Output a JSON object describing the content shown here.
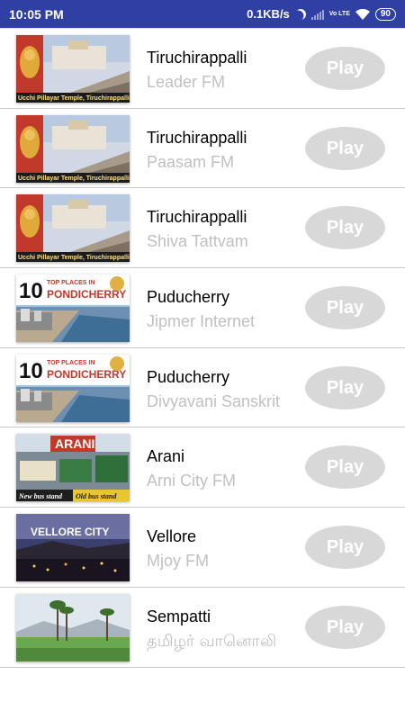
{
  "status_bar": {
    "time": "10:05 PM",
    "net_speed": "0.1KB/s",
    "volte": "Vo LTE",
    "battery": "90"
  },
  "stations": [
    {
      "city": "Tiruchirappalli",
      "name": "Leader FM",
      "play_label": "Play",
      "thumb": "temple",
      "thumb_caption": "Ucchi Pillayar Temple, Tiruchirappalli"
    },
    {
      "city": "Tiruchirappalli",
      "name": "Paasam FM",
      "play_label": "Play",
      "thumb": "temple",
      "thumb_caption": "Ucchi Pillayar Temple, Tiruchirappalli"
    },
    {
      "city": "Tiruchirappalli",
      "name": "Shiva Tattvam",
      "play_label": "Play",
      "thumb": "temple",
      "thumb_caption": "Ucchi Pillayar Temple, Tiruchirappalli"
    },
    {
      "city": "Puducherry",
      "name": "Jipmer Internet",
      "play_label": "Play",
      "thumb": "pondy",
      "thumb_caption": "10 TOP PLACES IN PONDICHERRY"
    },
    {
      "city": "Puducherry",
      "name": "Divyavani Sanskrit",
      "play_label": "Play",
      "thumb": "pondy",
      "thumb_caption": "10 TOP PLACES IN PONDICHERRY"
    },
    {
      "city": "Arani",
      "name": "Arni City FM",
      "play_label": "Play",
      "thumb": "arani",
      "thumb_caption": "ARANI New bus stand Old bus stand"
    },
    {
      "city": "Vellore",
      "name": "Mjoy FM",
      "play_label": "Play",
      "thumb": "vellore",
      "thumb_caption": "VELLORE CITY"
    },
    {
      "city": "Sempatti",
      "name": "தமிழர் வானொலி",
      "play_label": "Play",
      "thumb": "palm",
      "thumb_caption": ""
    }
  ]
}
